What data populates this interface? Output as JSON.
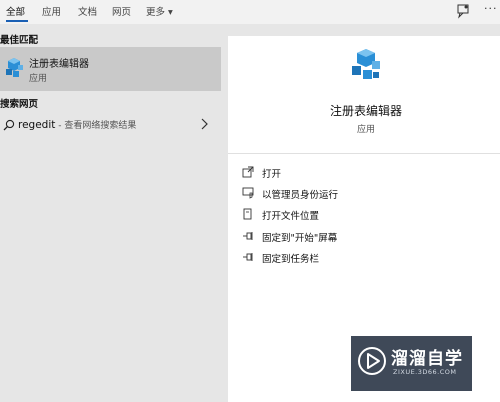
{
  "tabs": [
    {
      "label": "全部"
    },
    {
      "label": "应用"
    },
    {
      "label": "文档"
    },
    {
      "label": "网页"
    },
    {
      "label": "更多 ▾"
    }
  ],
  "best_match": {
    "header": "最佳匹配",
    "name": "注册表编辑器",
    "kind": "应用",
    "icon": "registry-editor-icon"
  },
  "web_search": {
    "header": "搜索网页",
    "query": "regedit",
    "hint": " - 查看网络搜索结果"
  },
  "detail": {
    "title": "注册表编辑器",
    "kind": "应用",
    "actions": [
      {
        "label": "打开",
        "icon": "open-icon"
      },
      {
        "label": "以管理员身份运行",
        "icon": "admin-shield-icon"
      },
      {
        "label": "打开文件位置",
        "icon": "file-location-icon"
      },
      {
        "label": "固定到\"开始\"屏幕",
        "icon": "pin-icon"
      },
      {
        "label": "固定到任务栏",
        "icon": "pin-icon"
      }
    ]
  },
  "watermark": {
    "text": "溜溜自学",
    "url": "ZIXUE.3D66.COM"
  },
  "colors": {
    "accent": "#1a5fb4",
    "selected_row": "#c9c9c9",
    "icon_blue": "#2a8fd6"
  }
}
